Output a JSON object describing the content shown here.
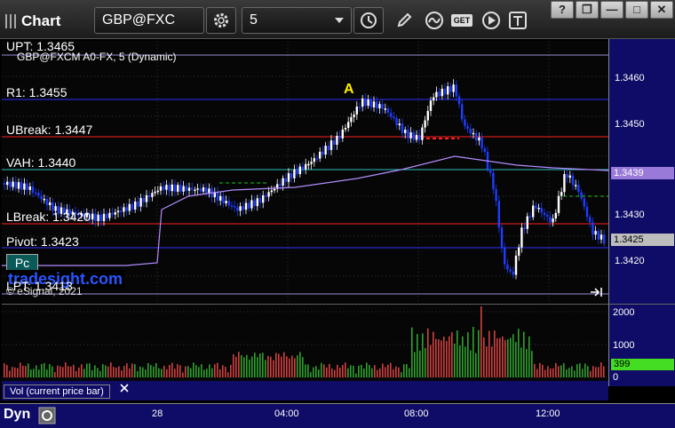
{
  "window": {
    "title": "Chart"
  },
  "toolbar": {
    "symbol": "GBP@FXC",
    "interval": "5",
    "gear_icon": "gear-icon",
    "clock_icon": "clock-icon",
    "pencil_icon": "pencil-icon",
    "wave_icon": "squiggle-icon",
    "get_label": "GET",
    "play_icon": "play-icon",
    "text_icon": "text-tool-icon"
  },
  "window_controls": {
    "help": "?",
    "restore": "❐",
    "minimize": "—",
    "maximize": "□",
    "close": "✕"
  },
  "chart": {
    "legend": "GBP@FXCM A0-FX, 5 (Dynamic)",
    "annotation": "A",
    "copyright": "© eSignal, 2021",
    "watermark": "tradesight.com",
    "pc_label": "Pc",
    "current_price": "1.3425",
    "vah_price": "1.3439",
    "colors": {
      "up_candle": "#ffffff",
      "down_candle": "#1e3cff",
      "vwap": "#b48cff",
      "resistance": "#ff2020",
      "pivot": "#3030ff",
      "vah": "#30c0c0"
    }
  },
  "levels": [
    {
      "label": "UPT: 1.3465"
    },
    {
      "label": "R1: 1.3455"
    },
    {
      "label": "UBreak: 1.3447"
    },
    {
      "label": "VAH: 1.3440"
    },
    {
      "label": "LBreak: 1.3420"
    },
    {
      "label": "Pivot: 1.3423"
    },
    {
      "label": "LPT: 1.3413"
    }
  ],
  "price_axis": [
    "1.3460",
    "1.3450",
    "1.3430",
    "1.3420"
  ],
  "volume": {
    "legend": "Vol (current price bar)",
    "close_icon": "close-icon",
    "axis": [
      "2000",
      "1000",
      "0"
    ],
    "current": "399"
  },
  "time_axis": [
    "28",
    "04:00",
    "08:00",
    "12:00"
  ],
  "footer": {
    "dyn_label": "Dyn"
  }
}
